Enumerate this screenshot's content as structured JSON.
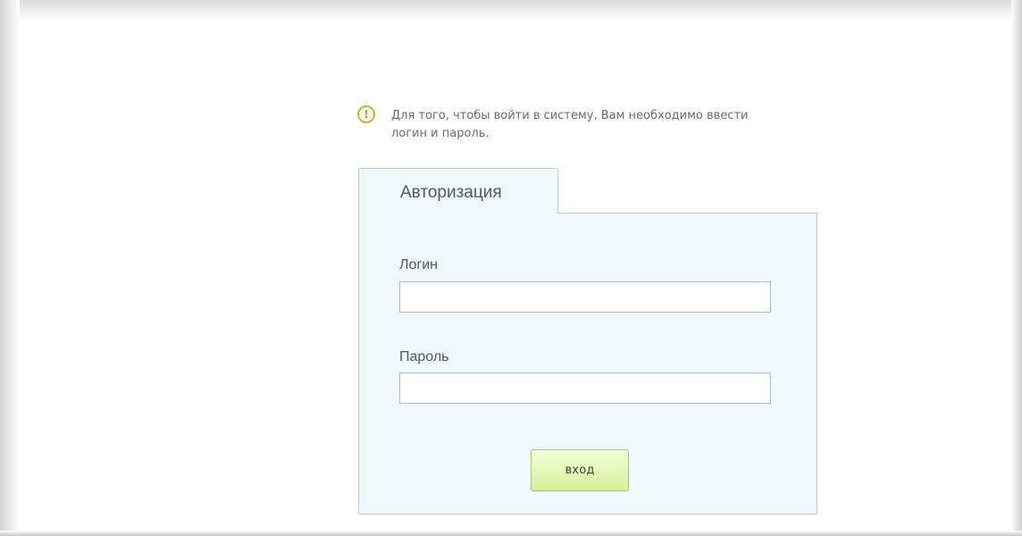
{
  "notice": {
    "icon": "info-exclamation-icon",
    "text": "Для того, чтобы войти в систему, Вам необходимо ввести\nлогин и пароль."
  },
  "auth": {
    "tab_label": "Авторизация",
    "login_label": "Логин",
    "login_value": "",
    "password_label": "Пароль",
    "password_value": "",
    "submit_label": "вход"
  },
  "colors": {
    "panel_background": "#f2f7fc",
    "panel_border": "#b7c9da",
    "button_green_top": "#f4ffd7",
    "button_green_bottom": "#d7ef9a",
    "notice_icon": "#c9b03a"
  }
}
